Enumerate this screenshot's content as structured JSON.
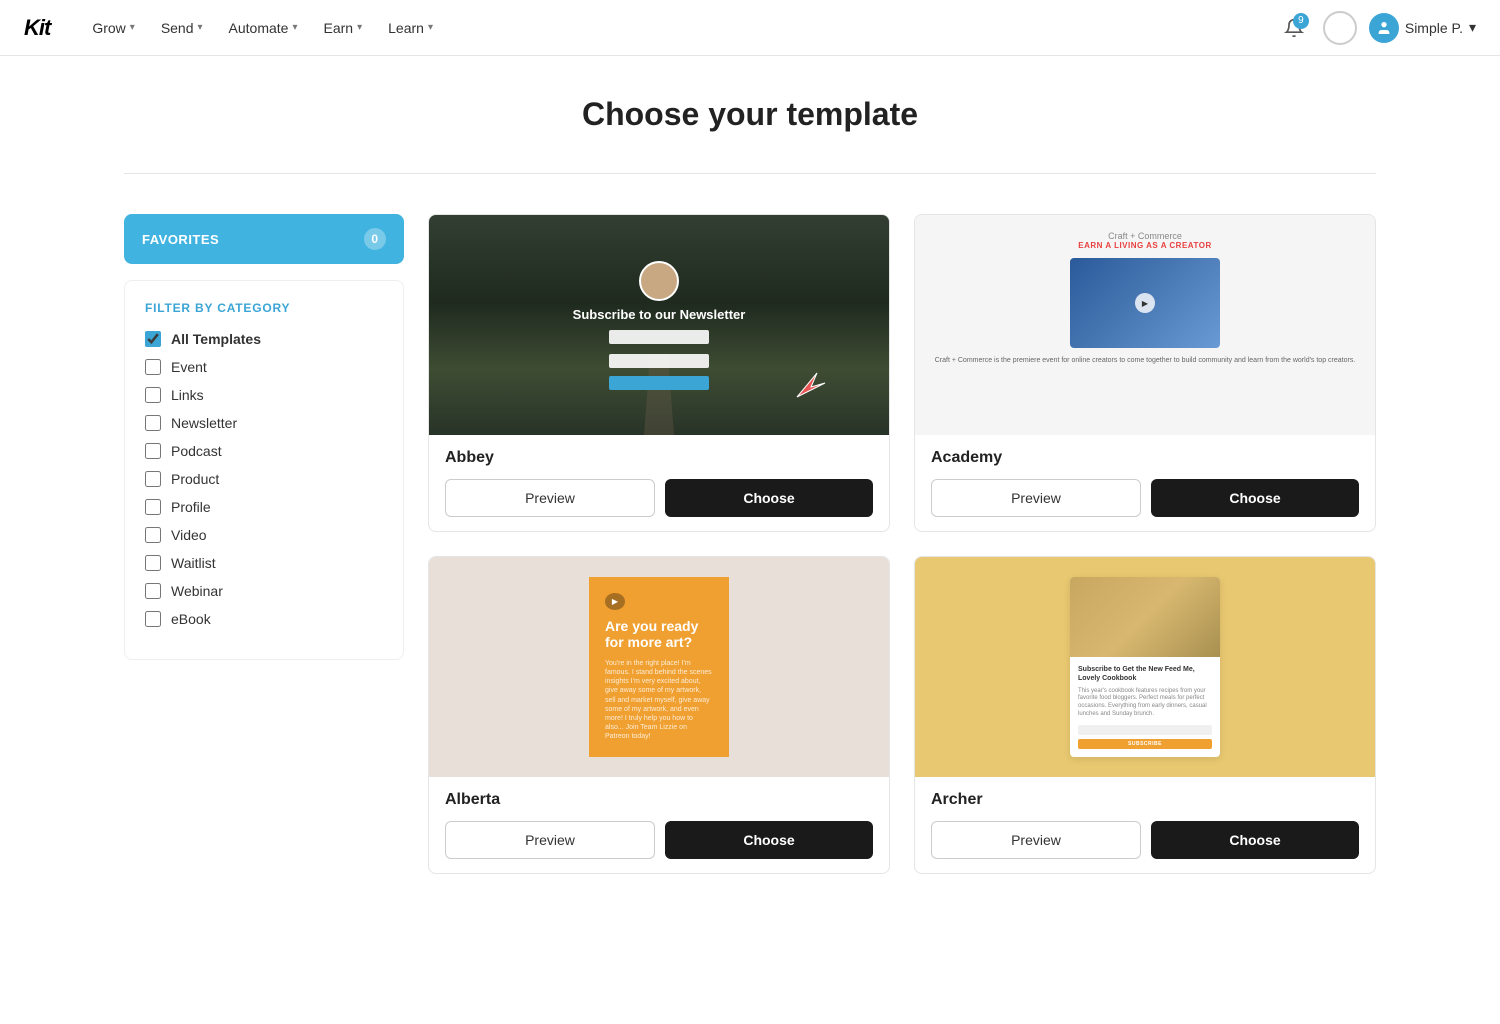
{
  "brand": {
    "name": "Kit"
  },
  "navbar": {
    "links": [
      {
        "label": "Grow",
        "id": "grow"
      },
      {
        "label": "Send",
        "id": "send"
      },
      {
        "label": "Automate",
        "id": "automate"
      },
      {
        "label": "Earn",
        "id": "earn"
      },
      {
        "label": "Learn",
        "id": "learn"
      }
    ],
    "notification_count": "9",
    "user_name": "Simple P."
  },
  "page": {
    "title": "Choose your template"
  },
  "sidebar": {
    "favorites_label": "FAVORITES",
    "favorites_count": "0",
    "filter_title": "FILTER BY CATEGORY",
    "categories": [
      {
        "label": "All Templates",
        "checked": true
      },
      {
        "label": "Event",
        "checked": false
      },
      {
        "label": "Links",
        "checked": false
      },
      {
        "label": "Newsletter",
        "checked": false
      },
      {
        "label": "Podcast",
        "checked": false
      },
      {
        "label": "Product",
        "checked": false
      },
      {
        "label": "Profile",
        "checked": false
      },
      {
        "label": "Video",
        "checked": false
      },
      {
        "label": "Waitlist",
        "checked": false
      },
      {
        "label": "Webinar",
        "checked": false
      },
      {
        "label": "eBook",
        "checked": false
      }
    ]
  },
  "templates": [
    {
      "id": "abbey",
      "name": "Abbey",
      "preview_label": "Preview",
      "choose_label": "Choose"
    },
    {
      "id": "academy",
      "name": "Academy",
      "preview_label": "Preview",
      "choose_label": "Choose"
    },
    {
      "id": "alberta",
      "name": "Alberta",
      "preview_label": "Preview",
      "choose_label": "Choose"
    },
    {
      "id": "archer",
      "name": "Archer",
      "preview_label": "Preview",
      "choose_label": "Choose"
    }
  ]
}
